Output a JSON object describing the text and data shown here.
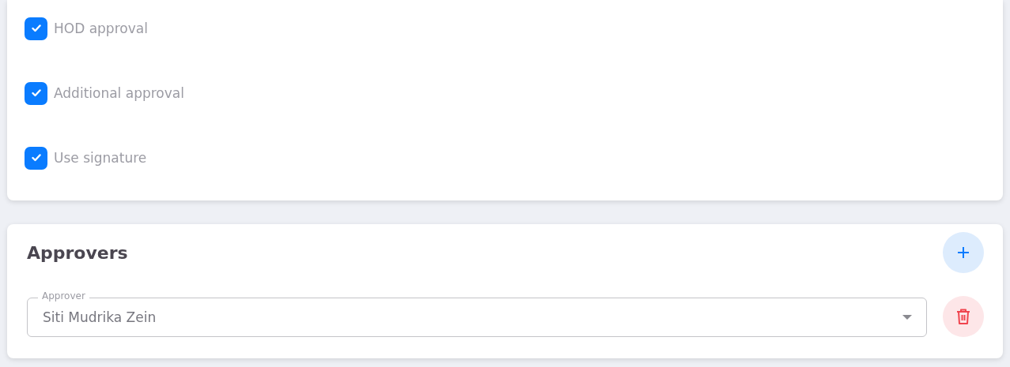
{
  "options": [
    {
      "label": "HOD approval",
      "checked": true
    },
    {
      "label": "Additional approval",
      "checked": true
    },
    {
      "label": "Use signature",
      "checked": true
    }
  ],
  "approvers": {
    "title": "Approvers",
    "rows": [
      {
        "label": "Approver",
        "value": "Siti Mudrika Zein"
      }
    ]
  }
}
